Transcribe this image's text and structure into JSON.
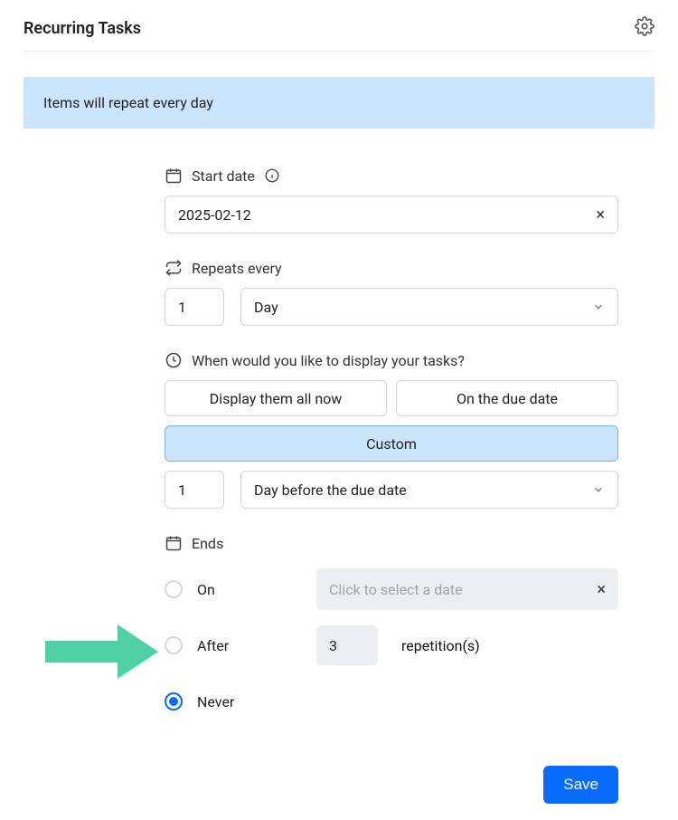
{
  "header": {
    "title": "Recurring Tasks"
  },
  "banner": "Items will repeat every day",
  "startDate": {
    "label": "Start date",
    "value": "2025-02-12"
  },
  "repeats": {
    "label": "Repeats every",
    "count": "1",
    "unit": "Day"
  },
  "display": {
    "label": "When would you like to display your tasks?",
    "options": {
      "allNow": "Display them all now",
      "onDue": "On the due date",
      "custom": "Custom"
    },
    "customCount": "1",
    "customUnit": "Day before the due date"
  },
  "ends": {
    "label": "Ends",
    "on": {
      "label": "On",
      "placeholder": "Click to select a date"
    },
    "after": {
      "label": "After",
      "value": "3",
      "suffix": "repetition(s)"
    },
    "never": {
      "label": "Never"
    }
  },
  "save": "Save"
}
